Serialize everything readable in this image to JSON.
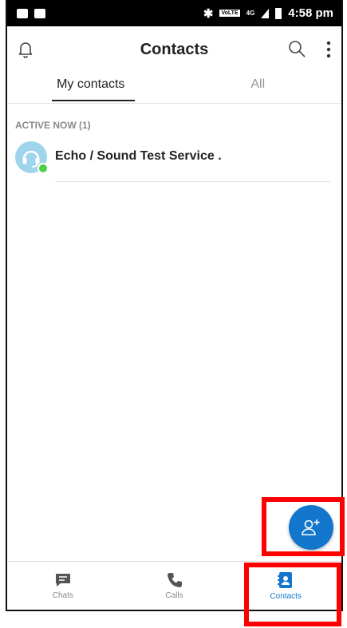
{
  "status_bar": {
    "network_label": "VoLTE",
    "network_type": "4G",
    "time": "4:58 pm"
  },
  "header": {
    "title": "Contacts"
  },
  "tabs": [
    {
      "label": "My contacts",
      "active": true
    },
    {
      "label": "All",
      "active": false
    }
  ],
  "active_now": {
    "label": "ACTIVE NOW (1)",
    "contacts": [
      {
        "name": "Echo / Sound Test Service ."
      }
    ]
  },
  "bottom_nav": [
    {
      "label": "Chats",
      "icon": "chat-icon"
    },
    {
      "label": "Calls",
      "icon": "phone-icon"
    },
    {
      "label": "Contacts",
      "icon": "contacts-book-icon",
      "active": true
    }
  ],
  "colors": {
    "accent": "#1176cc",
    "online": "#4bd046",
    "highlight": "#ff0000"
  }
}
